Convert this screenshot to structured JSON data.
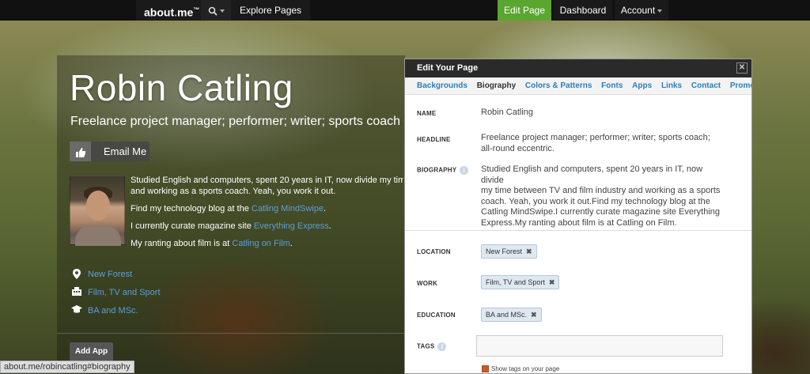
{
  "topnav": {
    "logo_main": "about",
    "logo_dot": ".",
    "logo_end": "me",
    "logo_tm": "™",
    "explore": "Explore Pages",
    "edit_page": "Edit Page",
    "dashboard": "Dashboard",
    "account": "Account"
  },
  "profile": {
    "name": "Robin Catling",
    "headline": "Freelance project manager; performer; writer; sports coach",
    "email_button": "Email Me",
    "bio": [
      "Studied English and computers, spent 20 years in IT, now divide my time between TV and film industry",
      "and working as a sports coach. Yeah, you work it out."
    ],
    "blog_prefix": "Find my technology blog at the ",
    "blog_link": "Catling MindSwipe",
    "blog_suffix": ".",
    "mag_prefix": "I currently curate magazine site ",
    "mag_link": "Everything Express",
    "mag_suffix": ".",
    "film_prefix": "My ranting about film is at ",
    "film_link": "Catling on Film",
    "film_suffix": ".",
    "location": "New Forest",
    "work": "Film, TV and Sport",
    "education": "BA and MSc.",
    "add_app": "Add App"
  },
  "status_url": "about.me/robincatling#biography",
  "panel": {
    "title": "Edit Your Page",
    "close": "✕",
    "tabs": [
      {
        "label": "Backgrounds"
      },
      {
        "label": "Biography"
      },
      {
        "label": "Colors & Patterns"
      },
      {
        "label": "Fonts"
      },
      {
        "label": "Apps"
      },
      {
        "label": "Links"
      },
      {
        "label": "Contact"
      },
      {
        "label": "Promote"
      }
    ],
    "name_label": "NAME",
    "name_value": "Robin Catling",
    "headline_label": "HEADLINE",
    "headline_value_1": "Freelance project manager; performer; writer; sports coach;",
    "headline_value_2": "all-round eccentric.",
    "bio_label": "BIOGRAPHY",
    "bio_value": [
      "Studied English and computers, spent 20 years in IT, now divide",
      "my time between TV and film industry and working as a sports",
      "coach. Yeah, you work it out.Find my technology blog at the",
      "Catling MindSwipe.I currently curate magazine site Everything",
      "Express.My ranting about film is at Catling on Film."
    ],
    "location_label": "LOCATION",
    "location_tag": "New Forest",
    "work_label": "WORK",
    "work_tag": "Film, TV and Sport",
    "education_label": "EDUCATION",
    "education_tag": "BA and MSc.",
    "tags_label": "TAGS",
    "show_tags": "Show tags on your page",
    "remove": "✖",
    "info": "i"
  },
  "colors": {
    "accent_green": "#5aa630",
    "link_blue": "#2c7fb8",
    "topnav_bg": "#111111"
  }
}
